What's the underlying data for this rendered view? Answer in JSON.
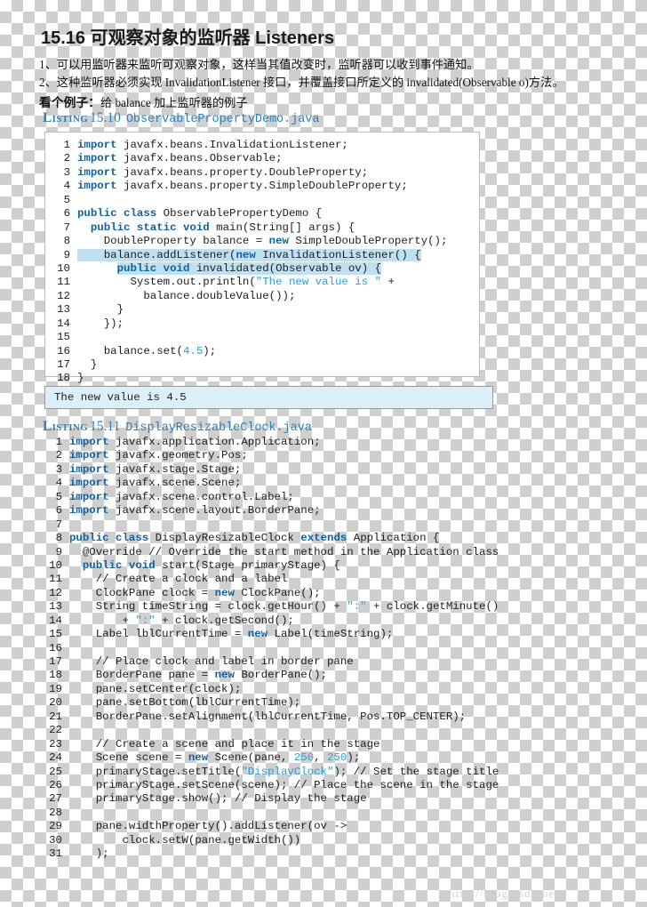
{
  "document": {
    "title": "15.16 可观察对象的监听器 Listeners",
    "bullets": [
      "1、可以用监听器来监听可观察对象，这样当其值改变时，监听器可以收到事件通知。",
      "2、这种监听器必须实现 InvalidationListener 接口，并覆盖接口所定义的 invalidated(Observable o)方法。"
    ],
    "example_lead": "看个例子：",
    "example_rest": "给 balance 加上监听器的例子",
    "watermark": "http://blog.csdn.net/"
  },
  "listing1": {
    "keyword": "Listing",
    "number": "15.10",
    "filename": "ObservablePropertyDemo.java",
    "lines": [
      {
        "n": "1",
        "segs": [
          {
            "t": "import",
            "c": "kw"
          },
          {
            "t": " javafx.beans.InvalidationListener;",
            "c": ""
          }
        ]
      },
      {
        "n": "2",
        "segs": [
          {
            "t": "import",
            "c": "kw"
          },
          {
            "t": " javafx.beans.Observable;",
            "c": ""
          }
        ]
      },
      {
        "n": "3",
        "segs": [
          {
            "t": "import",
            "c": "kw"
          },
          {
            "t": " javafx.beans.property.DoubleProperty;",
            "c": ""
          }
        ]
      },
      {
        "n": "4",
        "segs": [
          {
            "t": "import",
            "c": "kw"
          },
          {
            "t": " javafx.beans.property.SimpleDoubleProperty;",
            "c": ""
          }
        ]
      },
      {
        "n": "5",
        "segs": []
      },
      {
        "n": "6",
        "segs": [
          {
            "t": "public class",
            "c": "kw"
          },
          {
            "t": " ObservablePropertyDemo {",
            "c": ""
          }
        ]
      },
      {
        "n": "7",
        "segs": [
          {
            "t": "  ",
            "c": ""
          },
          {
            "t": "public static void",
            "c": "kw"
          },
          {
            "t": " main(String[] args) {",
            "c": ""
          }
        ]
      },
      {
        "n": "8",
        "segs": [
          {
            "t": "    DoubleProperty balance = ",
            "c": ""
          },
          {
            "t": "new",
            "c": "kw"
          },
          {
            "t": " SimpleDoubleProperty();",
            "c": ""
          }
        ]
      },
      {
        "n": "9",
        "segs": [
          {
            "t": "    balance.addListener(",
            "c": "hl"
          },
          {
            "t": "new",
            "c": "kw hl"
          },
          {
            "t": " InvalidationListener() {",
            "c": "hl"
          }
        ]
      },
      {
        "n": "10",
        "segs": [
          {
            "t": "      ",
            "c": ""
          },
          {
            "t": "public void",
            "c": "kw hl"
          },
          {
            "t": " invalidated(Observable ov) {",
            "c": "hl"
          }
        ]
      },
      {
        "n": "11",
        "segs": [
          {
            "t": "        System.out.println(",
            "c": ""
          },
          {
            "t": "\"The new value is \"",
            "c": "str"
          },
          {
            "t": " +",
            "c": ""
          }
        ]
      },
      {
        "n": "12",
        "segs": [
          {
            "t": "          balance.doubleValue());",
            "c": ""
          }
        ]
      },
      {
        "n": "13",
        "segs": [
          {
            "t": "      }",
            "c": ""
          }
        ]
      },
      {
        "n": "14",
        "segs": [
          {
            "t": "    });",
            "c": ""
          }
        ]
      },
      {
        "n": "15",
        "segs": []
      },
      {
        "n": "16",
        "segs": [
          {
            "t": "    balance.set(",
            "c": ""
          },
          {
            "t": "4.5",
            "c": "num"
          },
          {
            "t": ");",
            "c": ""
          }
        ]
      },
      {
        "n": "17",
        "segs": [
          {
            "t": "  }",
            "c": ""
          }
        ]
      },
      {
        "n": "18",
        "segs": [
          {
            "t": "}",
            "c": ""
          }
        ]
      }
    ]
  },
  "output": {
    "text": "The new value is 4.5"
  },
  "listing2": {
    "keyword": "Listing",
    "number": "15.11",
    "filename": "DisplayResizableClock.java",
    "lines": [
      {
        "n": "1",
        "segs": [
          {
            "t": "import",
            "c": "kw"
          },
          {
            "t": " javafx.application.Application;",
            "c": ""
          }
        ]
      },
      {
        "n": "2",
        "segs": [
          {
            "t": "import",
            "c": "kw"
          },
          {
            "t": " javafx.geometry.Pos;",
            "c": ""
          }
        ]
      },
      {
        "n": "3",
        "segs": [
          {
            "t": "import",
            "c": "kw"
          },
          {
            "t": " javafx.stage.Stage;",
            "c": ""
          }
        ]
      },
      {
        "n": "4",
        "segs": [
          {
            "t": "import",
            "c": "kw"
          },
          {
            "t": " javafx.scene.Scene;",
            "c": ""
          }
        ]
      },
      {
        "n": "5",
        "segs": [
          {
            "t": "import",
            "c": "kw"
          },
          {
            "t": " javafx.scene.control.Label;",
            "c": ""
          }
        ]
      },
      {
        "n": "6",
        "segs": [
          {
            "t": "import",
            "c": "kw"
          },
          {
            "t": " javafx.scene.layout.BorderPane;",
            "c": ""
          }
        ]
      },
      {
        "n": "7",
        "segs": []
      },
      {
        "n": "8",
        "segs": [
          {
            "t": "public class",
            "c": "kw"
          },
          {
            "t": " DisplayResizableClock ",
            "c": ""
          },
          {
            "t": "extends",
            "c": "kw"
          },
          {
            "t": " Application {",
            "c": ""
          }
        ]
      },
      {
        "n": "9",
        "segs": [
          {
            "t": "  @Override // Override the start method in the Application class",
            "c": ""
          }
        ]
      },
      {
        "n": "10",
        "segs": [
          {
            "t": "  ",
            "c": ""
          },
          {
            "t": "public void",
            "c": "kw"
          },
          {
            "t": " start(Stage primaryStage) {",
            "c": ""
          }
        ]
      },
      {
        "n": "11",
        "segs": [
          {
            "t": "    // Create a clock and a label",
            "c": ""
          }
        ]
      },
      {
        "n": "12",
        "segs": [
          {
            "t": "    ClockPane clock = ",
            "c": ""
          },
          {
            "t": "new",
            "c": "kw"
          },
          {
            "t": " ClockPane();",
            "c": ""
          }
        ]
      },
      {
        "n": "13",
        "segs": [
          {
            "t": "    String timeString = clock.getHour() + ",
            "c": ""
          },
          {
            "t": "\":\"",
            "c": "str"
          },
          {
            "t": " + clock.getMinute()",
            "c": ""
          }
        ]
      },
      {
        "n": "14",
        "segs": [
          {
            "t": "        + ",
            "c": ""
          },
          {
            "t": "\":\"",
            "c": "str"
          },
          {
            "t": " + clock.getSecond();",
            "c": ""
          }
        ]
      },
      {
        "n": "15",
        "segs": [
          {
            "t": "    Label lblCurrentTime = ",
            "c": ""
          },
          {
            "t": "new",
            "c": "kw"
          },
          {
            "t": " Label(timeString);",
            "c": ""
          }
        ]
      },
      {
        "n": "16",
        "segs": []
      },
      {
        "n": "17",
        "segs": [
          {
            "t": "    // Place clock and label in border pane",
            "c": ""
          }
        ]
      },
      {
        "n": "18",
        "segs": [
          {
            "t": "    BorderPane pane = ",
            "c": ""
          },
          {
            "t": "new",
            "c": "kw"
          },
          {
            "t": " BorderPane();",
            "c": ""
          }
        ]
      },
      {
        "n": "19",
        "segs": [
          {
            "t": "    pane.setCenter(clock);",
            "c": ""
          }
        ]
      },
      {
        "n": "20",
        "segs": [
          {
            "t": "    pane.setBottom(lblCurrentTime);",
            "c": ""
          }
        ]
      },
      {
        "n": "21",
        "segs": [
          {
            "t": "    BorderPane.setAlignment(lblCurrentTime, Pos.TOP_CENTER);",
            "c": ""
          }
        ]
      },
      {
        "n": "22",
        "segs": []
      },
      {
        "n": "23",
        "segs": [
          {
            "t": "    // Create a scene and place it in the stage",
            "c": ""
          }
        ]
      },
      {
        "n": "24",
        "segs": [
          {
            "t": "    Scene scene = ",
            "c": ""
          },
          {
            "t": "new",
            "c": "kw"
          },
          {
            "t": " Scene(pane, ",
            "c": ""
          },
          {
            "t": "250",
            "c": "num"
          },
          {
            "t": ", ",
            "c": ""
          },
          {
            "t": "250",
            "c": "num"
          },
          {
            "t": ");",
            "c": ""
          }
        ]
      },
      {
        "n": "25",
        "segs": [
          {
            "t": "    primaryStage.setTitle(",
            "c": ""
          },
          {
            "t": "\"DisplayClock\"",
            "c": "str"
          },
          {
            "t": "); // Set the stage title",
            "c": ""
          }
        ]
      },
      {
        "n": "26",
        "segs": [
          {
            "t": "    primaryStage.setScene(scene); // Place the scene in the stage",
            "c": ""
          }
        ]
      },
      {
        "n": "27",
        "segs": [
          {
            "t": "    primaryStage.show(); // Display the stage",
            "c": ""
          }
        ]
      },
      {
        "n": "28",
        "segs": []
      },
      {
        "n": "29",
        "segs": [
          {
            "t": "    pane.widthProperty().addListener(ov ->",
            "c": ""
          }
        ]
      },
      {
        "n": "30",
        "segs": [
          {
            "t": "        clock.setW(pane.getWidth())",
            "c": ""
          }
        ]
      },
      {
        "n": "31",
        "segs": [
          {
            "t": "    );",
            "c": ""
          }
        ]
      }
    ]
  }
}
